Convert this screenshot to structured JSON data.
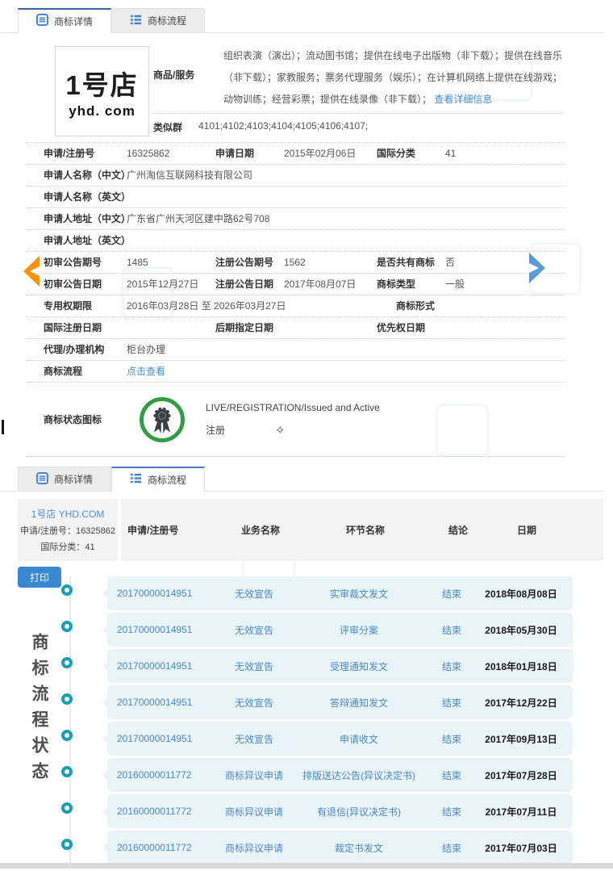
{
  "colors": {
    "accent_blue": "#35639c",
    "active_tab2_blue": "#4a7ebb",
    "link_blue": "#3f8fd8",
    "value_blue": "#4a87c8",
    "timeline_teal": "#17a0b4",
    "bubble_bg": "#e9f4f8",
    "print_blue": "#3a87d2",
    "badge_green": "#2f9e44",
    "arrow_orange": "#f5930f",
    "arrow_blue": "#5b9bd5"
  },
  "tabs": {
    "detail_label": "商标详情",
    "process_label": "商标流程"
  },
  "detail": {
    "logo_line1": "1号店",
    "logo_line2": "yhd. com",
    "goods": {
      "label": "商品/服务",
      "text": "组织表演（演出）；流动图书馆；提供在线电子出版物（非下载）；提供在线音乐（非下载）；家教服务；票务代理服务（娱乐）；在计算机网络上提供在线游戏；动物训练；经营彩票；提供在线录像（非下载）；",
      "link": "查看详细信息"
    },
    "similar_group": {
      "label": "类似群",
      "value": "4101;4102;4103;4104;4105;4106;4107;"
    },
    "fields": {
      "reg_no": {
        "label": "申请/注册号",
        "value": "16325862"
      },
      "app_date": {
        "label": "申请日期",
        "value": "2015年02月06日"
      },
      "intl_class": {
        "label": "国际分类",
        "value": "41"
      },
      "applicant_cn": {
        "label": "申请人名称（中文）",
        "value": "广州淘信互联网科技有限公司"
      },
      "applicant_en": {
        "label": "申请人名称（英文）",
        "value": ""
      },
      "addr_cn": {
        "label": "申请人地址（中文）",
        "value": "广东省广州天河区建中路62号708"
      },
      "addr_en": {
        "label": "申请人地址（英文）",
        "value": ""
      },
      "prelim_no": {
        "label": "初审公告期号",
        "value": "1485"
      },
      "reg_gazette_no": {
        "label": "注册公告期号",
        "value": "1562"
      },
      "co_owned": {
        "label": "是否共有商标",
        "value": "否"
      },
      "prelim_date": {
        "label": "初审公告日期",
        "value": "2015年12月27日"
      },
      "reg_gazette_date": {
        "label": "注册公告日期",
        "value": "2017年08月07日"
      },
      "mark_type": {
        "label": "商标类型",
        "value": "一般"
      },
      "term": {
        "label": "专用权期限",
        "value": "2016年03月28日 至 2026年03月27日"
      },
      "mark_form": {
        "label": "商标形式",
        "value": ""
      },
      "intl_reg_date": {
        "label": "国际注册日期",
        "value": ""
      },
      "late_designation": {
        "label": "后期指定日期",
        "value": ""
      },
      "priority_date": {
        "label": "优先权日期",
        "value": ""
      },
      "agency": {
        "label": "代理/办理机构",
        "value": "柜台办理"
      },
      "flow": {
        "label": "商标流程",
        "link": "点击查看"
      }
    },
    "status": {
      "label": "商标状态图标",
      "line1": "LIVE/REGISTRATION/Issued and Active",
      "line2": "注册"
    }
  },
  "process": {
    "panel": {
      "title": "1号店 YHD.COM",
      "reg_line": "申请/注册号：16325862",
      "class_line": "国际分类：41"
    },
    "print_label": "打印",
    "side_label": "商标流程状态",
    "headers": {
      "no": "申请/注册号",
      "biz": "业务名称",
      "step": "环节名称",
      "result": "结论",
      "date": "日期"
    },
    "rows": [
      {
        "no": "20170000014951",
        "biz": "无效宣告",
        "step": "实审裁文发文",
        "result": "结束",
        "date": "2018年08月08日"
      },
      {
        "no": "20170000014951",
        "biz": "无效宣告",
        "step": "评审分案",
        "result": "结束",
        "date": "2018年05月30日"
      },
      {
        "no": "20170000014951",
        "biz": "无效宣告",
        "step": "受理通知发文",
        "result": "结束",
        "date": "2018年01月18日"
      },
      {
        "no": "20170000014951",
        "biz": "无效宣告",
        "step": "答辩通知发文",
        "result": "结束",
        "date": "2017年12月22日"
      },
      {
        "no": "20170000014951",
        "biz": "无效宣告",
        "step": "申请收文",
        "result": "结束",
        "date": "2017年09月13日"
      },
      {
        "no": "20160000011772",
        "biz": "商标异议申请",
        "step": "排版送达公告(异议决定书)",
        "result": "结束",
        "date": "2017年07月28日"
      },
      {
        "no": "20160000011772",
        "biz": "商标异议申请",
        "step": "有退信(异议决定书)",
        "result": "结束",
        "date": "2017年07月11日"
      },
      {
        "no": "20160000011772",
        "biz": "商标异议申请",
        "step": "裁定书发文",
        "result": "结束",
        "date": "2017年07月03日"
      }
    ]
  }
}
